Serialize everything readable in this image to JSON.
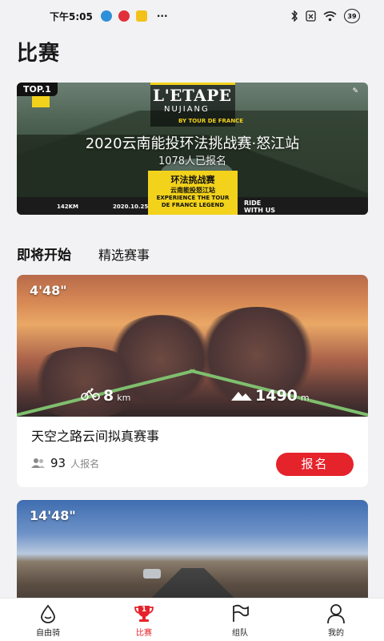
{
  "status_bar": {
    "time": "下午5:05",
    "more": "···",
    "battery": "39"
  },
  "page": {
    "title": "比赛"
  },
  "banner": {
    "badge": "TOP.1",
    "logo_title": "L'ETAPE",
    "logo_sub": "NUJIANG",
    "logo_tdf": "BY TOUR DE FRANCE",
    "title": "2020云南能投环法挑战赛·怒江站",
    "count": "1078人已报名",
    "panel_line1": "环法挑战赛",
    "panel_line2": "云南能投怒江站",
    "panel_line3": "EXPERIENCE THE TOUR",
    "panel_line4": "DE FRANCE LEGEND",
    "ride_line1": "RIDE",
    "ride_line2": "WITH US",
    "distance": "142KM",
    "date": "2020.10.25"
  },
  "tabs": {
    "upcoming": "即将开始",
    "featured": "精选赛事"
  },
  "events": [
    {
      "duration": "4'48\"",
      "distance_value": "8",
      "distance_unit": "km",
      "elevation_value": "1490",
      "elevation_unit": "m",
      "title": "天空之路云间拟真赛事",
      "signups": "93",
      "signup_label": "人报名",
      "action": "报名"
    },
    {
      "duration": "14'48\""
    }
  ],
  "nav": {
    "items": [
      {
        "label": "自由骑"
      },
      {
        "label": "比赛",
        "badge": "1"
      },
      {
        "label": "组队"
      },
      {
        "label": "我的"
      }
    ]
  },
  "colors": {
    "accent": "#e5232b",
    "banner_yellow": "#f2d21b",
    "route_green": "#7fbf6e"
  }
}
